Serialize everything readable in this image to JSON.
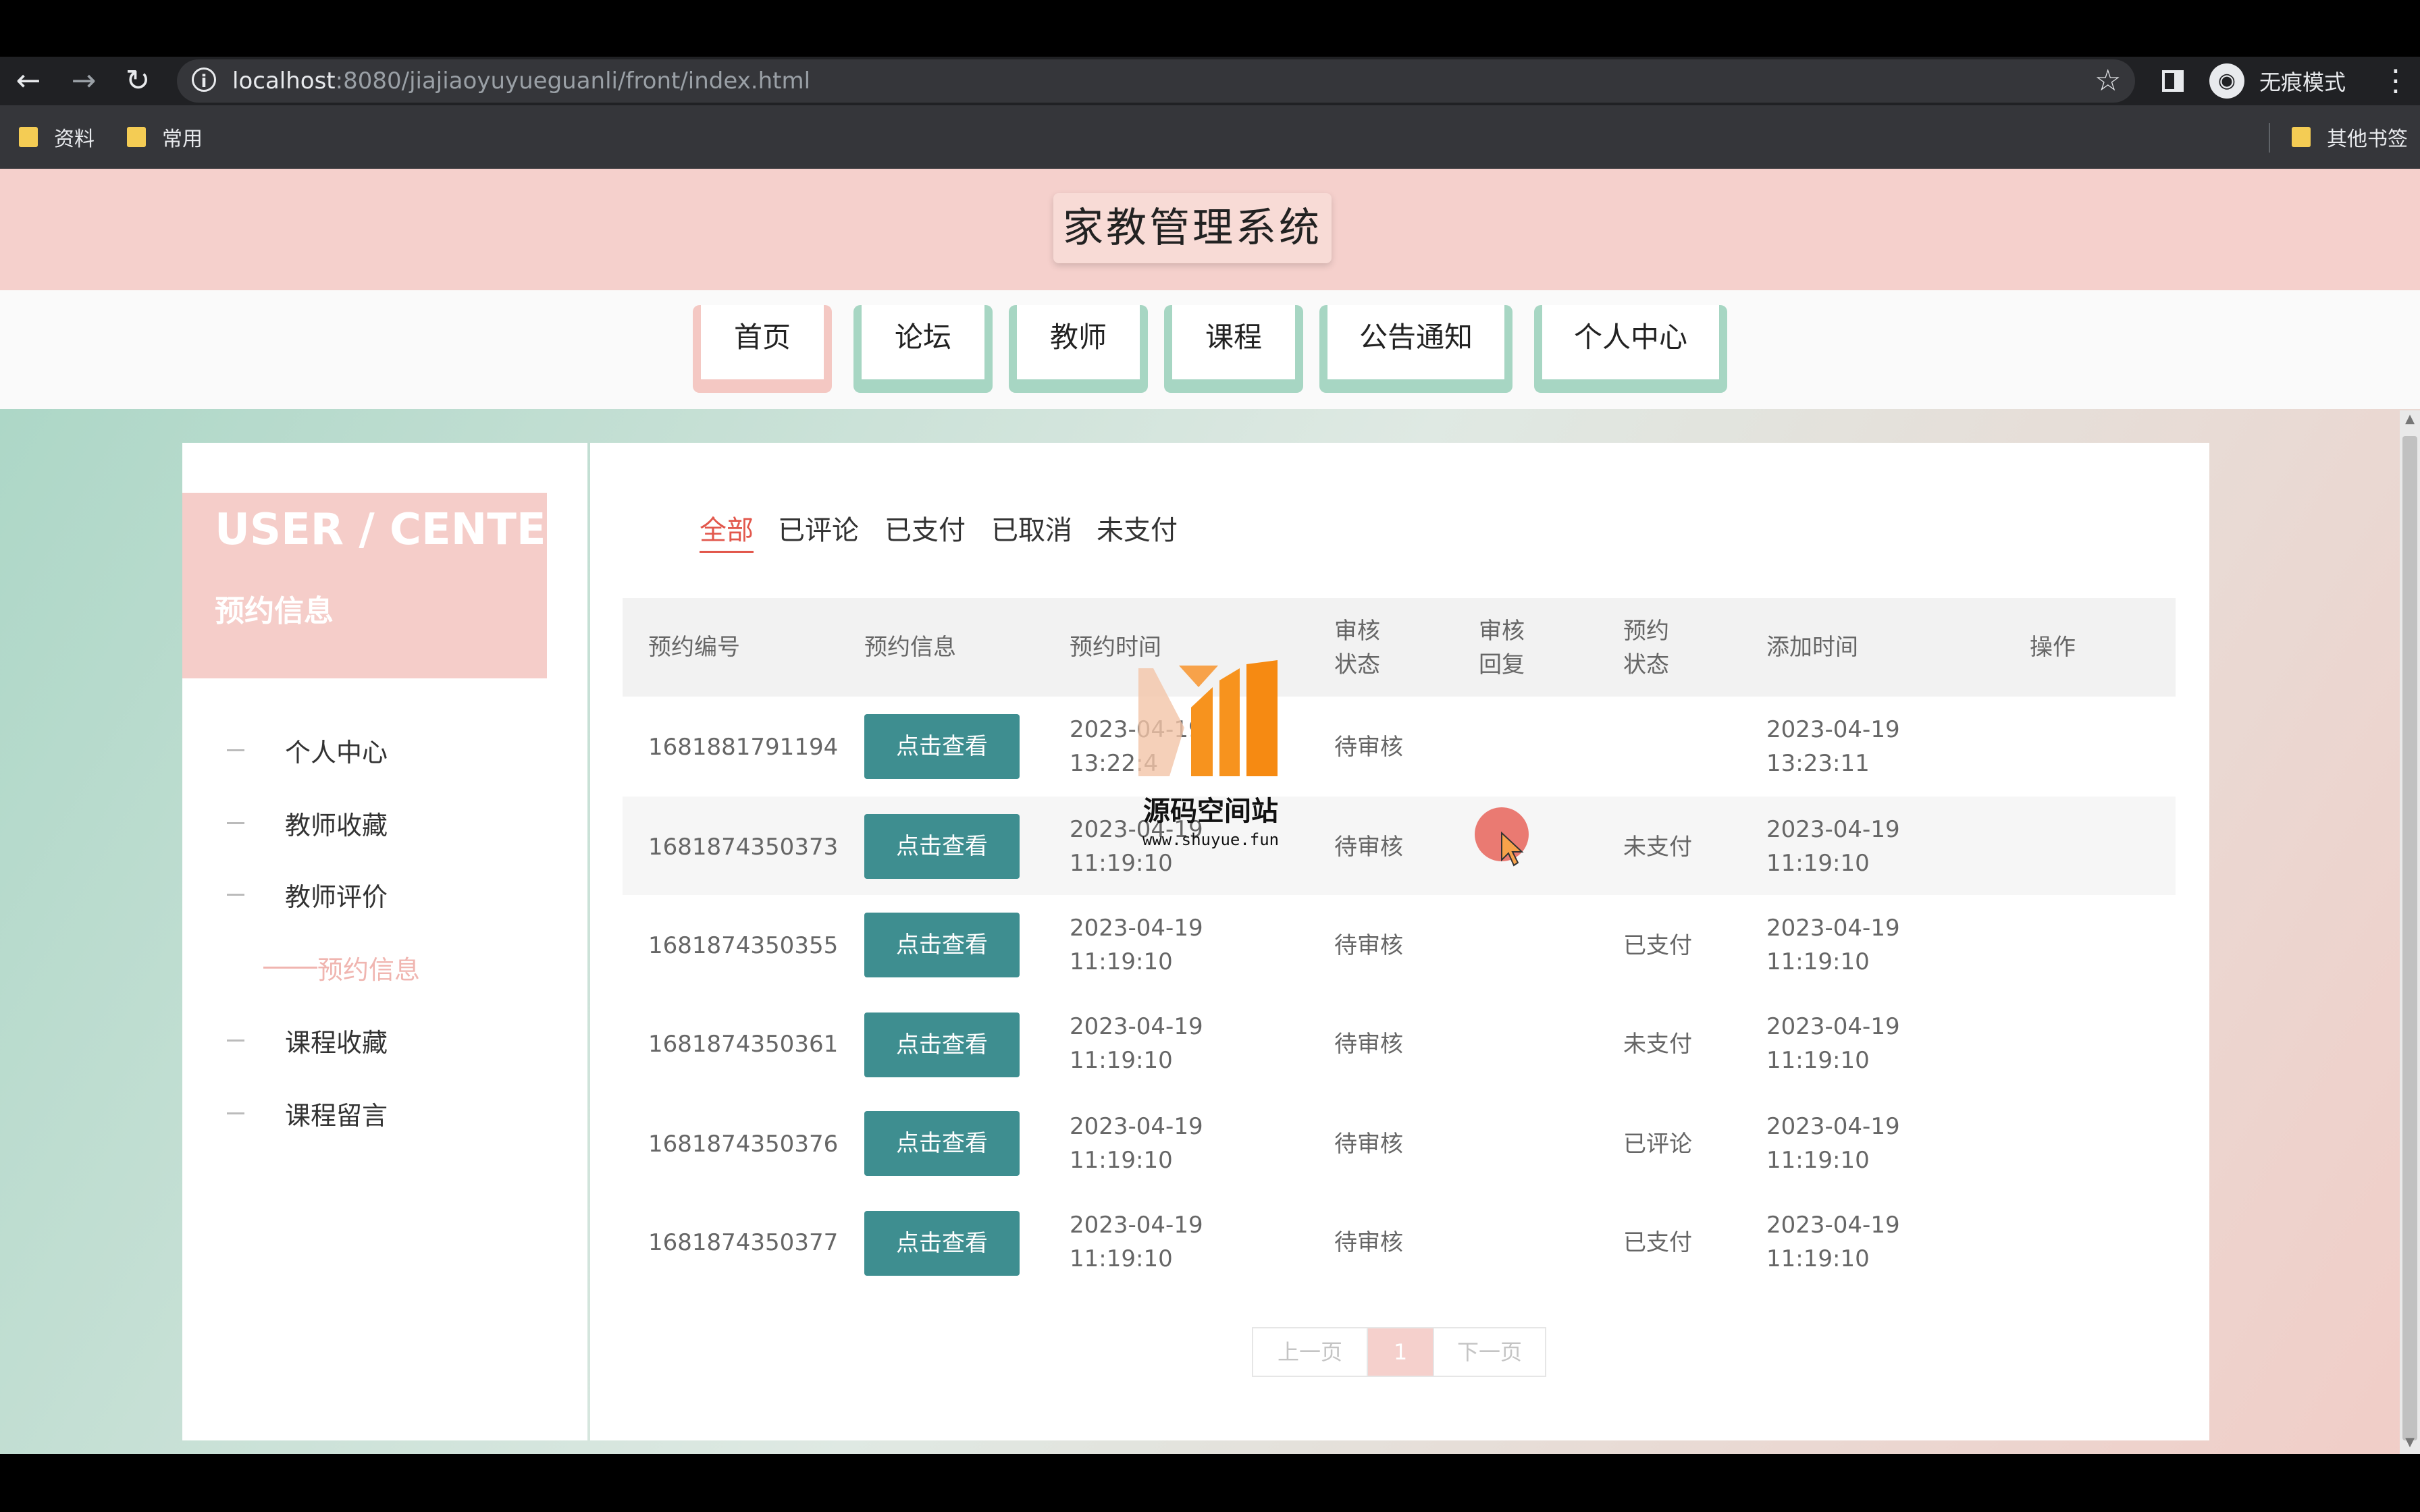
{
  "browser": {
    "url_host": "localhost",
    "url_rest": ":8080/jiajiaoyuyueguanli/front/index.html",
    "incognito_label": "无痕模式",
    "bookmarks": [
      "资料",
      "常用"
    ],
    "other_bookmarks": "其他书签"
  },
  "site": {
    "title": "家教管理系统",
    "nav": [
      "首页",
      "论坛",
      "教师",
      "课程",
      "公告通知",
      "个人中心"
    ]
  },
  "sidebar": {
    "title": "USER / CENTER",
    "subtitle": "预约信息",
    "items": [
      "个人中心",
      "教师收藏",
      "教师评价",
      "预约信息",
      "课程收藏",
      "课程留言"
    ]
  },
  "tabs": [
    "全部",
    "已评论",
    "已支付",
    "已取消",
    "未支付"
  ],
  "table": {
    "headers": [
      "预约编号",
      "预约信息",
      "预约时间",
      "审核状态",
      "审核回复",
      "预约状态",
      "添加时间",
      "操作"
    ],
    "view_label": "点击查看",
    "rows": [
      {
        "id": "1681881791194",
        "date": "2023-04-19",
        "time": "13:22:4",
        "audit": "待审核",
        "reply": "",
        "status": "",
        "add_date": "2023-04-19",
        "add_time": "13:23:11"
      },
      {
        "id": "1681874350373",
        "date": "2023-04-19",
        "time": "11:19:10",
        "audit": "待审核",
        "reply": "",
        "status": "未支付",
        "add_date": "2023-04-19",
        "add_time": "11:19:10"
      },
      {
        "id": "1681874350355",
        "date": "2023-04-19",
        "time": "11:19:10",
        "audit": "待审核",
        "reply": "",
        "status": "已支付",
        "add_date": "2023-04-19",
        "add_time": "11:19:10"
      },
      {
        "id": "1681874350361",
        "date": "2023-04-19",
        "time": "11:19:10",
        "audit": "待审核",
        "reply": "",
        "status": "未支付",
        "add_date": "2023-04-19",
        "add_time": "11:19:10"
      },
      {
        "id": "1681874350376",
        "date": "2023-04-19",
        "time": "11:19:10",
        "audit": "待审核",
        "reply": "",
        "status": "已评论",
        "add_date": "2023-04-19",
        "add_time": "11:19:10"
      },
      {
        "id": "1681874350377",
        "date": "2023-04-19",
        "time": "11:19:10",
        "audit": "待审核",
        "reply": "",
        "status": "已支付",
        "add_date": "2023-04-19",
        "add_time": "11:19:10"
      }
    ]
  },
  "pager": {
    "prev": "上一页",
    "current": "1",
    "next": "下一页"
  },
  "watermark": {
    "name": "源码空间站",
    "url": "www.shuyue.fun"
  },
  "colors": {
    "pink": "#f5d0cc",
    "teal": "#3e8e90",
    "mint": "#a8d5c4",
    "accent": "#e2574c"
  }
}
